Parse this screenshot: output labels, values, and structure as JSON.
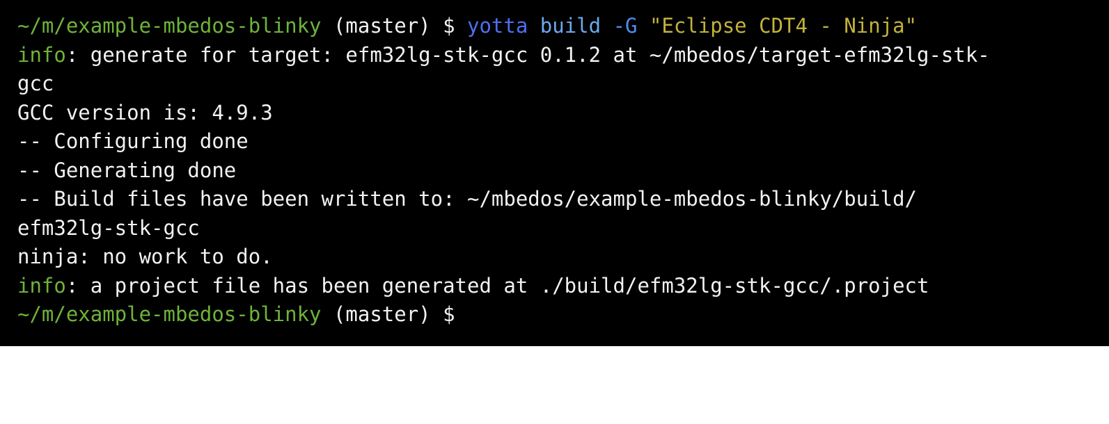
{
  "terminal": {
    "colors": {
      "background": "#000000",
      "text": "#f2f2f2",
      "prompt_path": "#6fb33a",
      "info_label": "#6fb33a",
      "command": "#4f6ff0",
      "subcommand": "#6ea8f0",
      "string_arg": "#c3b23b"
    },
    "line1": {
      "path": "~/m/example-mbedos-blinky",
      "branch": " (master) $ ",
      "cmd": "yotta",
      "sp1": " ",
      "sub": "build",
      "sp2": " ",
      "flag": "-G",
      "sp3": " ",
      "arg": "\"Eclipse CDT4 - Ninja\""
    },
    "line2": {
      "label": "info",
      "text": ": generate for target: efm32lg-stk-gcc 0.1.2 at ~/mbedos/target-efm32lg-stk-"
    },
    "line3": "gcc",
    "line4": "GCC version is: 4.9.3",
    "line5": "-- Configuring done",
    "line6": "-- Generating done",
    "line7": "-- Build files have been written to: ~/mbedos/example-mbedos-blinky/build/",
    "line8": "efm32lg-stk-gcc",
    "line9": "ninja: no work to do.",
    "line10": {
      "label": "info",
      "text": ": a project file has been generated at ./build/efm32lg-stk-gcc/.project"
    },
    "line11": {
      "path": "~/m/example-mbedos-blinky",
      "branch": " (master) $"
    }
  }
}
